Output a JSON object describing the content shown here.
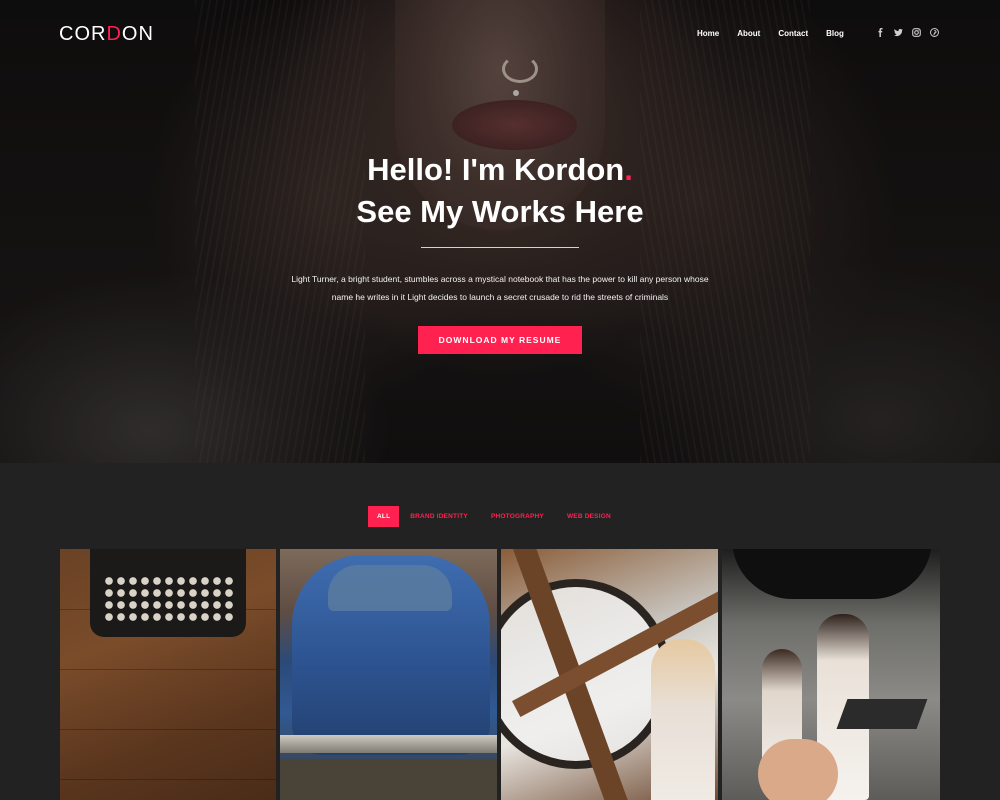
{
  "brand": {
    "logo_prefix": "COR",
    "logo_accent": "D",
    "logo_suffix": "ON"
  },
  "nav": {
    "items": [
      "Home",
      "About",
      "Contact",
      "Blog"
    ]
  },
  "social": [
    "facebook-icon",
    "twitter-icon",
    "instagram-icon",
    "pinterest-icon"
  ],
  "hero": {
    "line1": "Hello! I'm Kordon",
    "line1_dot": ".",
    "line2": "See My Works Here",
    "intro": "Light Turner, a bright student, stumbles across a mystical notebook that has the power to kill any person whose name he writes in it Light decides to launch a secret crusade to rid the streets of criminals",
    "cta": "DOWNLOAD MY RESUME"
  },
  "portfolio": {
    "filters": [
      "ALL",
      "BRAND IDENTITY",
      "PHOTOGRAPHY",
      "WEB DESIGN"
    ],
    "active_filter": "ALL",
    "items": [
      "typewriter",
      "blue-car",
      "clock-tower",
      "photo-studio"
    ]
  },
  "colors": {
    "accent": "#ff214f",
    "background": "#222222"
  }
}
